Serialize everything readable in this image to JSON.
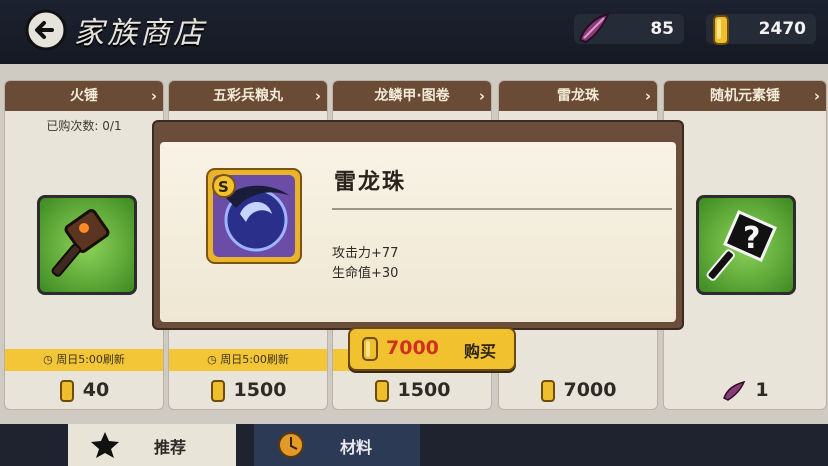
{
  "header": {
    "title": "家族商店",
    "back_icon": "back-arrow-icon",
    "feather_count": "85",
    "gold_count": "2470"
  },
  "cards": [
    {
      "name": "火锤",
      "sub": "已购次数: 0/1",
      "refresh": "周日5:00刷新",
      "price": "40",
      "currency": "gold"
    },
    {
      "name": "五彩兵粮丸",
      "sub": "",
      "refresh": "周日5:00刷新",
      "price": "1500",
      "currency": "gold"
    },
    {
      "name": "龙鳞甲·图卷",
      "sub": "",
      "refresh": "",
      "price": "1500",
      "currency": "gold"
    },
    {
      "name": "雷龙珠",
      "sub": "",
      "refresh": "",
      "price": "7000",
      "currency": "gold"
    },
    {
      "name": "随机元素锤",
      "sub": "",
      "refresh": "",
      "price": "1",
      "currency": "feather"
    }
  ],
  "modal": {
    "item_name": "雷龙珠",
    "stat1": "攻击力+77",
    "stat2": "生命值+30",
    "buy_price": "7000",
    "buy_label": "购买"
  },
  "tabs": {
    "recommended": "推荐",
    "materials": "材料"
  },
  "colors": {
    "price_red": "#d0311f",
    "button_gold": "#f2c130",
    "header_brown": "#6a4b36"
  }
}
